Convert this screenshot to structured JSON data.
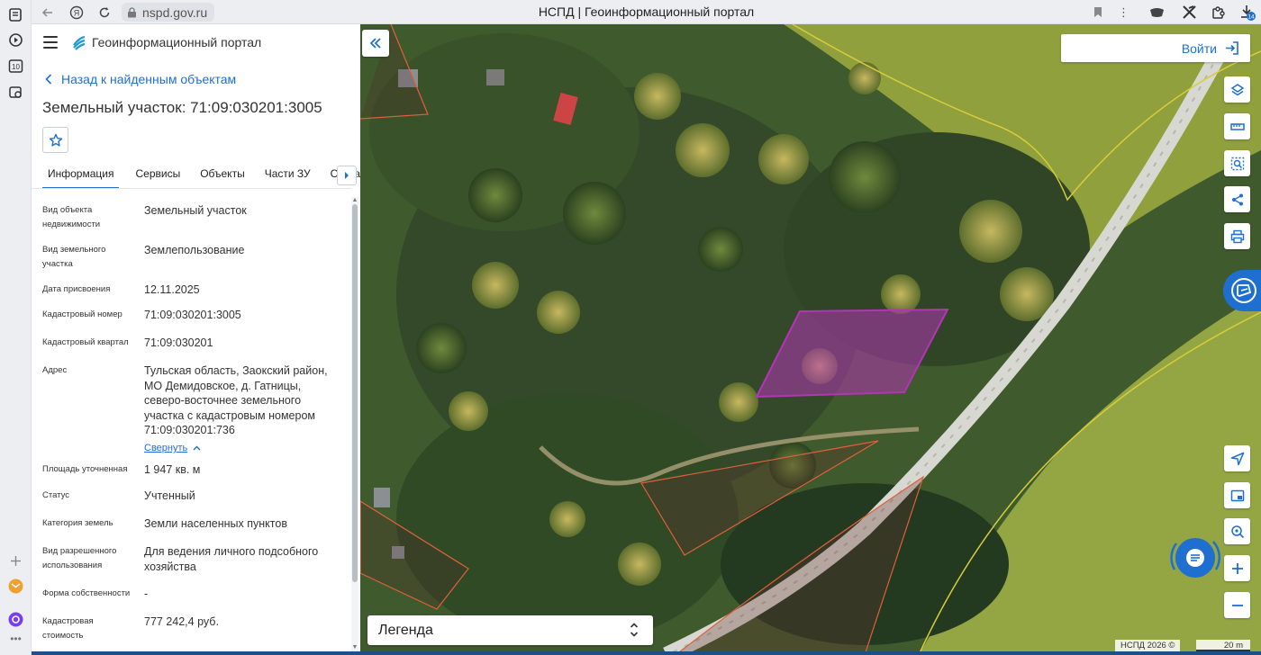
{
  "browser": {
    "url": "nspd.gov.ru",
    "tab_title": "НСПД | Геоинформационный портал",
    "badge_count": "14"
  },
  "panel": {
    "app_title": "Геоинформационный портал",
    "back_label": "Назад к найденным объектам",
    "title": "Земельный участок: 71:09:030201:3005",
    "tabs": [
      {
        "label": "Информация",
        "active": true
      },
      {
        "label": "Сервисы"
      },
      {
        "label": "Объекты"
      },
      {
        "label": "Части ЗУ"
      },
      {
        "label": "Состав"
      }
    ],
    "properties": [
      {
        "key": "Вид объекта недвижимости",
        "value": "Земельный участок"
      },
      {
        "key": "Вид земельного участка",
        "value": "Землепользование"
      },
      {
        "key": "Дата присвоения",
        "value": "12.11.2025"
      },
      {
        "key": "Кадастровый номер",
        "value": "71:09:030201:3005"
      },
      {
        "key": "Кадастровый квартал",
        "value": "71:09:030201"
      },
      {
        "key": "Адрес",
        "value": "Тульская область, Заокский район, МО Демидовское, д. Гатницы, северо-восточнее земельного участка с кадастровым номером 71:09:030201:736"
      },
      {
        "key": "Площадь уточненная",
        "value": "1 947 кв. м"
      },
      {
        "key": "Статус",
        "value": "Учтенный"
      },
      {
        "key": "Категория земель",
        "value": "Земли населенных пунктов"
      },
      {
        "key": "Вид разрешенного использования",
        "value": "Для ведения личного подсобного хозяйства"
      },
      {
        "key": "Форма собственности",
        "value": "-"
      },
      {
        "key": "Кадастровая стоимость",
        "value": "777 242,4 руб."
      }
    ],
    "collapse_label": "Свернуть"
  },
  "map": {
    "login_label": "Войти",
    "legend_label": "Легенда",
    "copyright": "НСПД 2026 ©",
    "scale_label": "20 m",
    "tools": [
      "layers-icon",
      "ruler-icon",
      "select-area-icon",
      "share-icon",
      "print-icon"
    ],
    "bottom_tools": [
      "locate-icon",
      "minimap-icon",
      "search-location-icon",
      "zoom-in-icon",
      "zoom-out-icon"
    ],
    "colors": {
      "accent": "#1f6fd1",
      "parcel": "#b235b5",
      "boundary": "#e0603a"
    }
  }
}
